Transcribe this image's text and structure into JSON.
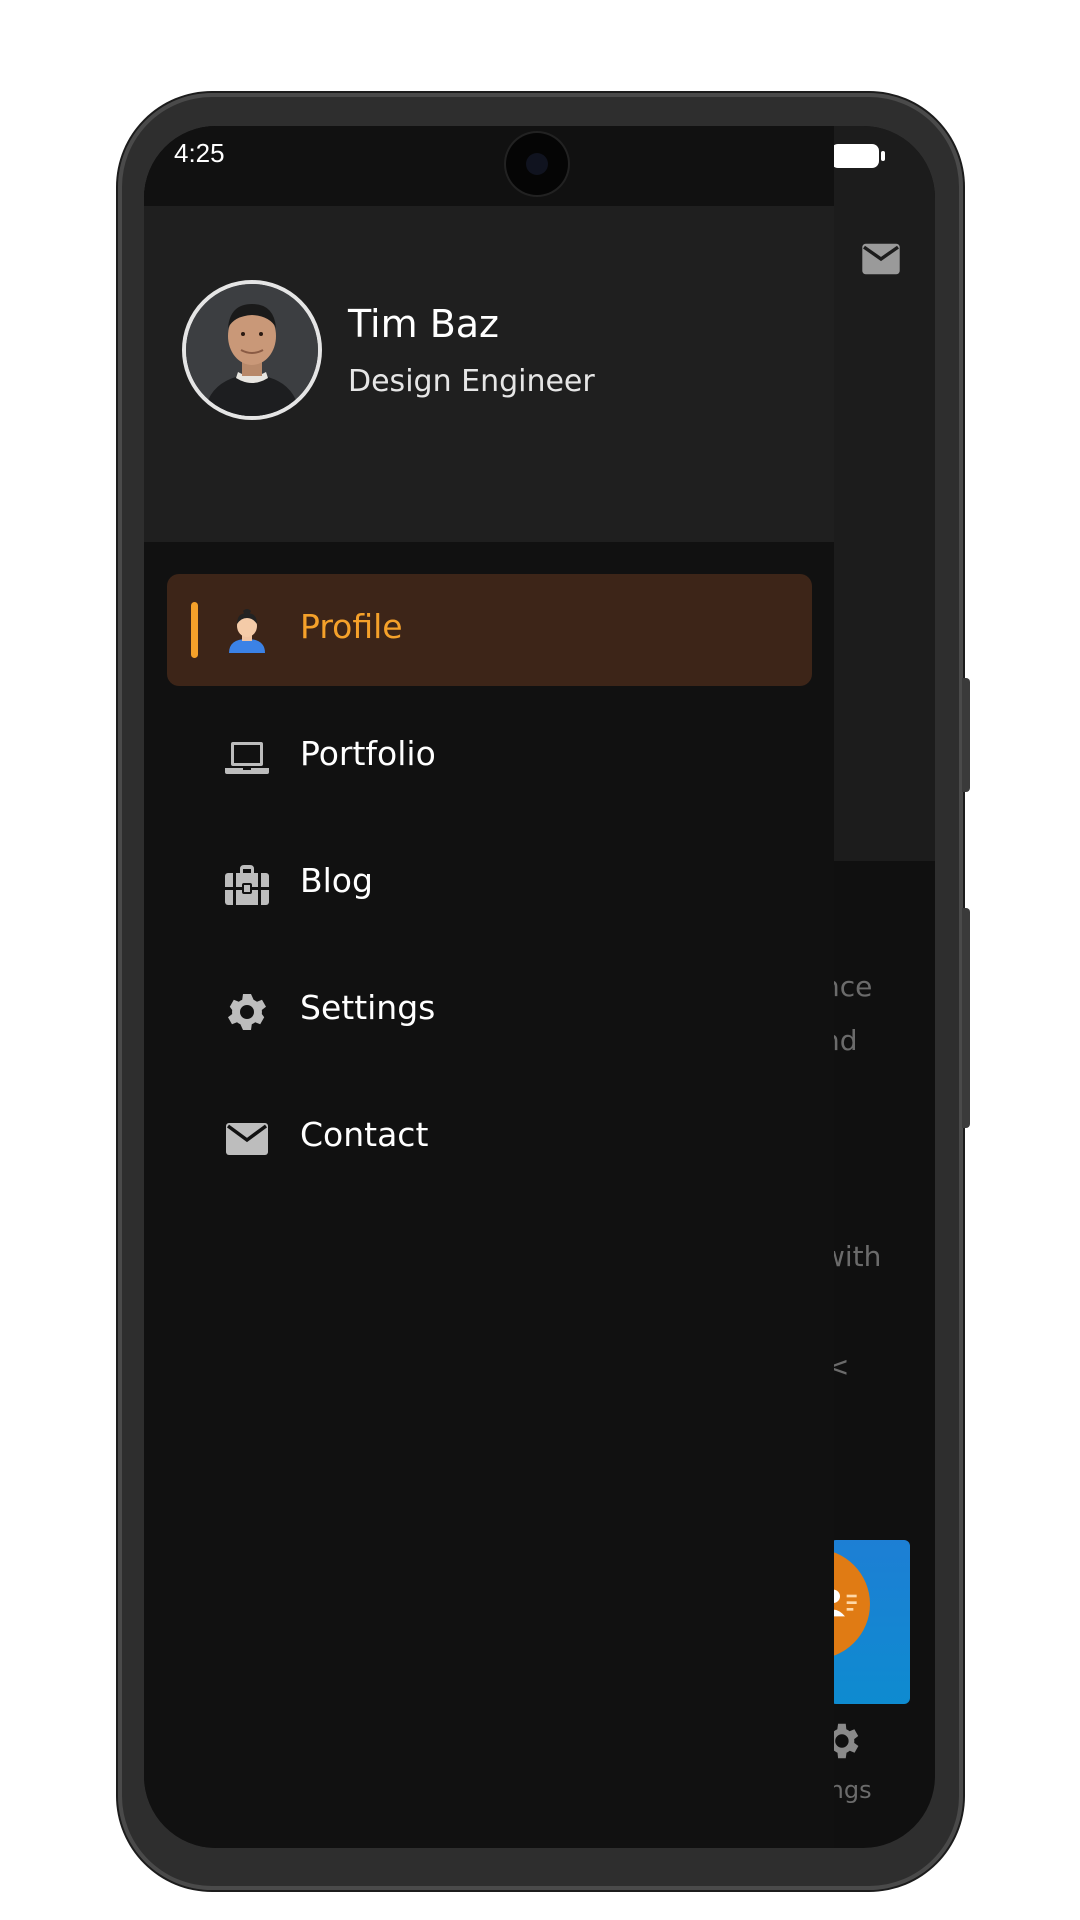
{
  "status_bar": {
    "time": "4:25"
  },
  "profile": {
    "name": "Tim Baz",
    "role": "Design Engineer"
  },
  "menu": {
    "items": [
      {
        "label": "Profile",
        "icon": "user-icon",
        "active": true
      },
      {
        "label": "Portfolio",
        "icon": "laptop-icon",
        "active": false
      },
      {
        "label": "Blog",
        "icon": "briefcase-icon",
        "active": false
      },
      {
        "label": "Settings",
        "icon": "gear-icon",
        "active": false
      },
      {
        "label": "Contact",
        "icon": "mail-icon",
        "active": false
      }
    ]
  },
  "background_page": {
    "text_fragments": [
      "nce",
      "nd",
      "with",
      "<"
    ],
    "nav_label_fragment": "ings"
  },
  "colors": {
    "accent": "#f5a12a",
    "active_bg": "#3d2518",
    "drawer_bg": "#111111",
    "header_bg": "#1f1f1f"
  }
}
